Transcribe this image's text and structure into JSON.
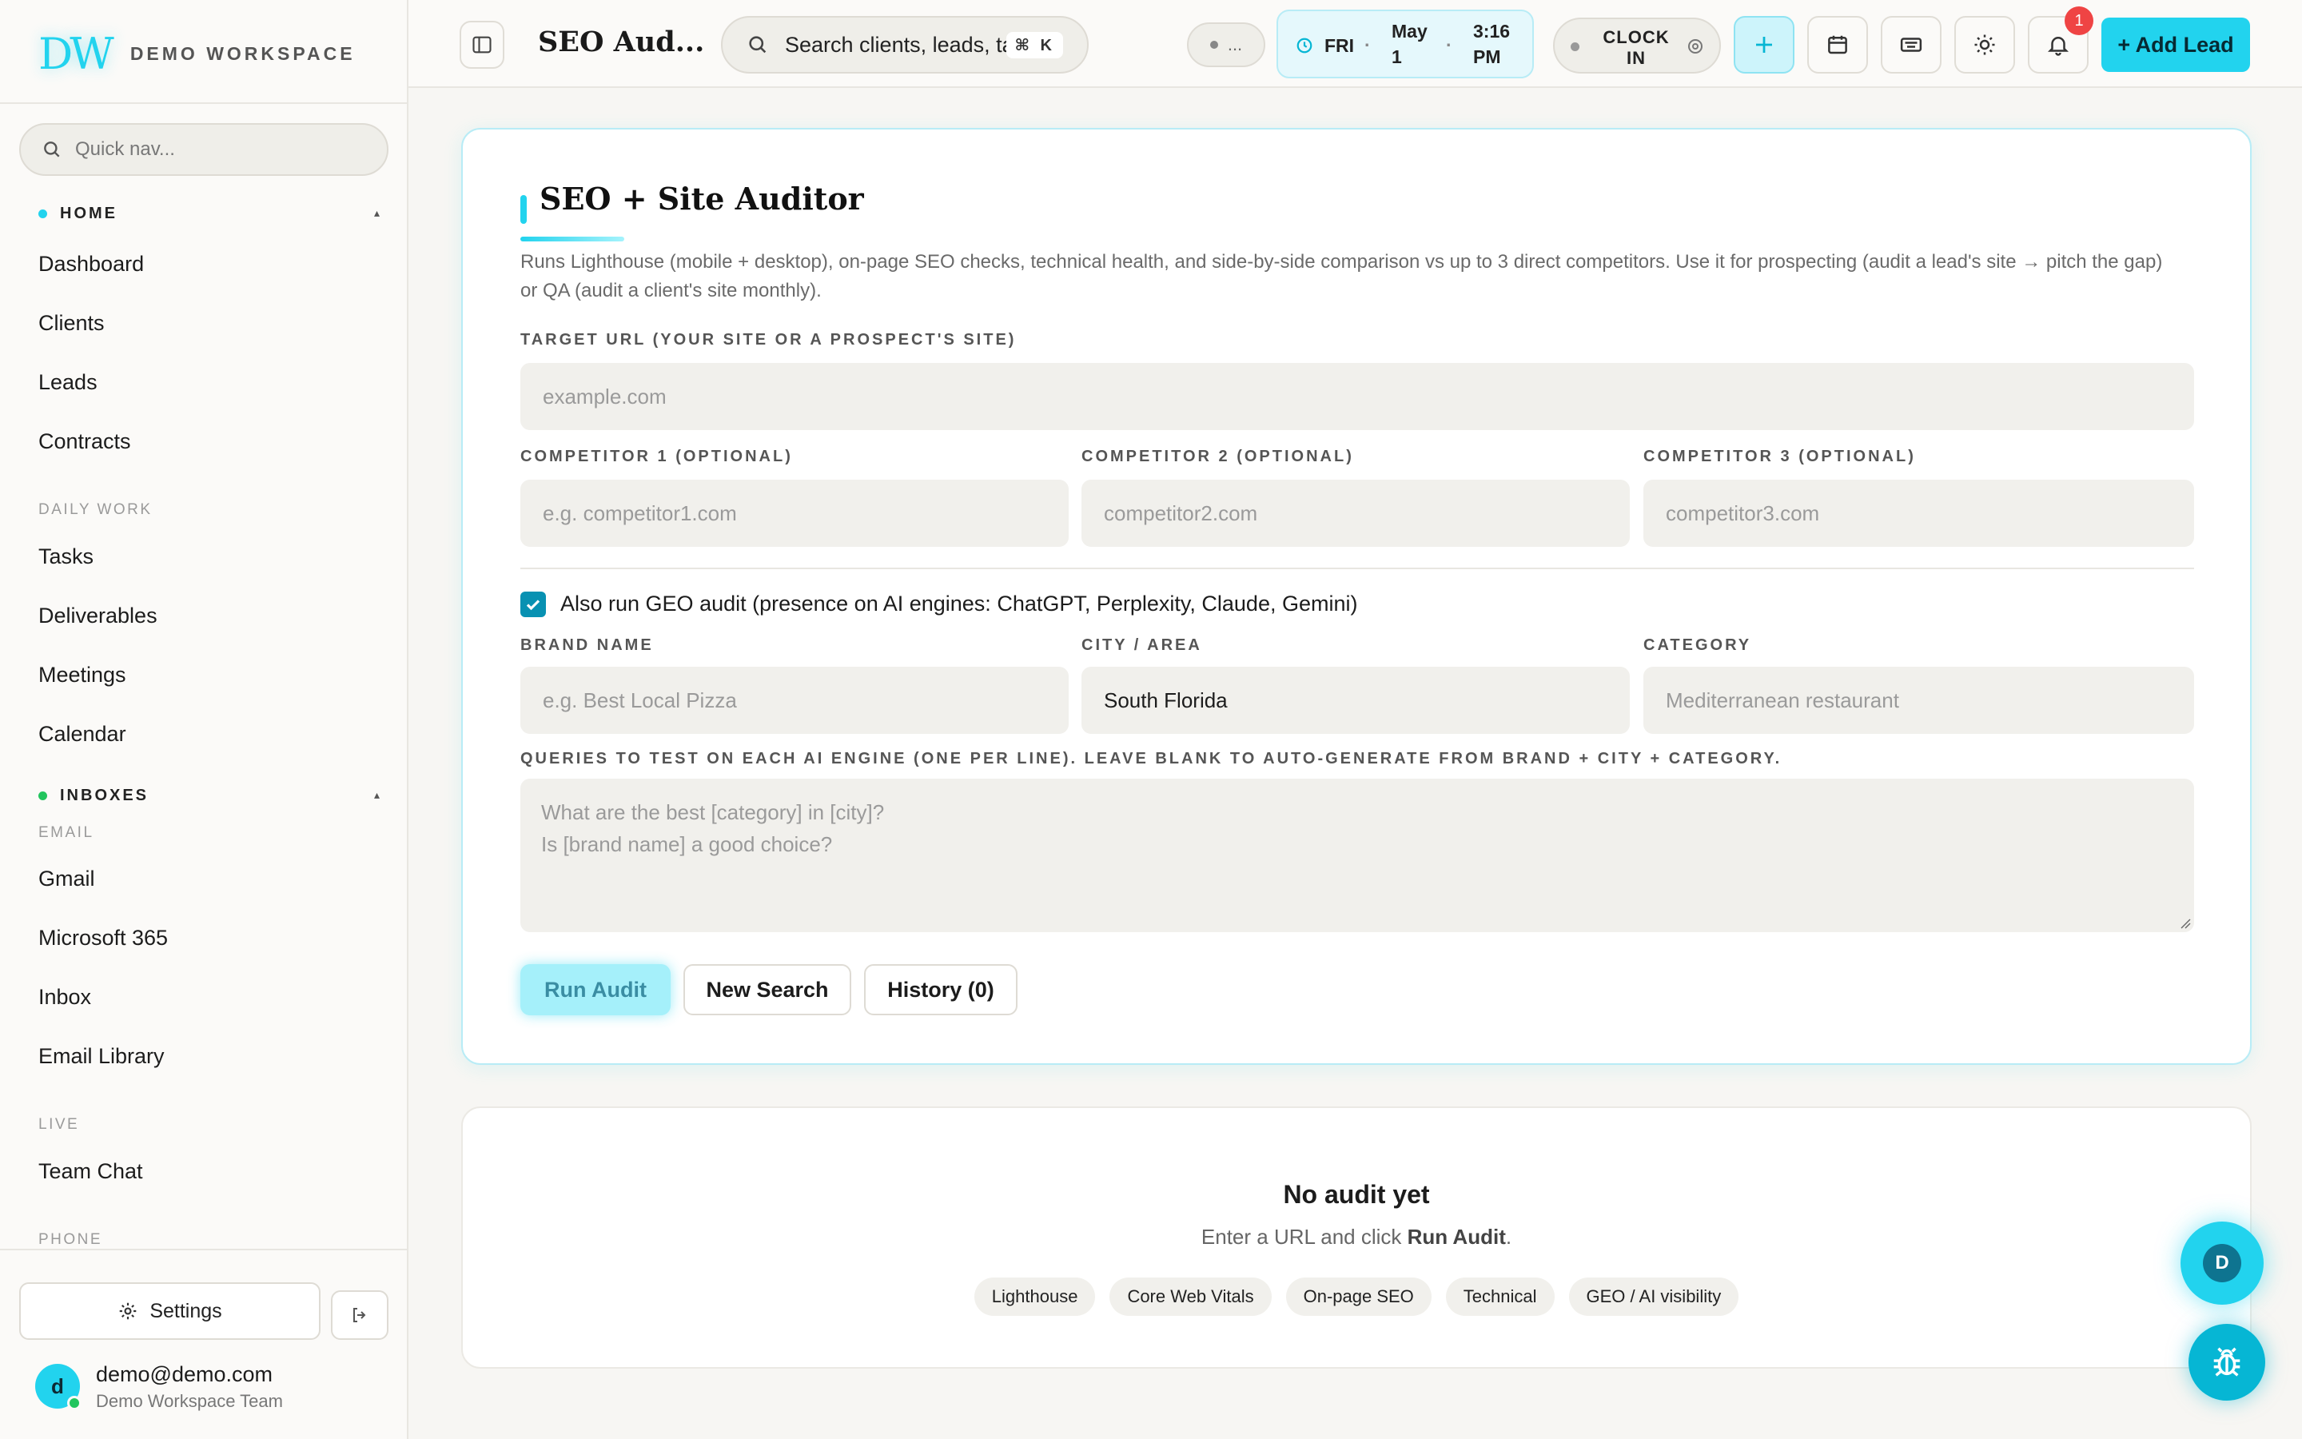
{
  "sidebar": {
    "brand_logo": "DW",
    "brand_name": "DEMO WORKSPACE",
    "quicknav_placeholder": "Quick nav...",
    "sections": {
      "home": {
        "label": "HOME",
        "color": "#22d3ee",
        "items": [
          "Dashboard",
          "Clients",
          "Leads",
          "Contracts"
        ]
      },
      "daily_work": {
        "label": "DAILY WORK",
        "items": [
          "Tasks",
          "Deliverables",
          "Meetings",
          "Calendar"
        ]
      },
      "inboxes": {
        "label": "INBOXES",
        "color": "#22c55e",
        "email_label": "EMAIL",
        "items": [
          "Gmail",
          "Microsoft 365",
          "Inbox",
          "Email Library"
        ]
      },
      "live": {
        "label": "LIVE",
        "items": [
          "Team Chat"
        ]
      },
      "phone": {
        "label": "PHONE"
      }
    },
    "settings_label": "Settings",
    "user": {
      "initial": "d",
      "email": "demo@demo.com",
      "team": "Demo Workspace Team"
    }
  },
  "header": {
    "title": "SEO Aud...",
    "search_text": "Search clients, leads, tasks...",
    "search_shortcut": "⌘ K",
    "status_text": "...",
    "date": {
      "day": "FRI",
      "month": "May",
      "date": "1",
      "time": "3:16",
      "ampm": "PM"
    },
    "clock_in_line1": "CLOCK",
    "clock_in_line2": "IN",
    "notification_count": "1",
    "add_lead_label": "+ Add Lead"
  },
  "auditor": {
    "title": "SEO + Site Auditor",
    "description": "Runs Lighthouse (mobile + desktop), on-page SEO checks, technical health, and side-by-side comparison vs up to 3 direct competitors. Use it for prospecting (audit a lead's site → pitch the gap) or QA (audit a client's site monthly).",
    "target_url_label": "TARGET URL (YOUR SITE OR A PROSPECT'S SITE)",
    "target_url_placeholder": "example.com",
    "competitors": [
      {
        "label": "COMPETITOR 1 (OPTIONAL)",
        "placeholder": "e.g. competitor1.com"
      },
      {
        "label": "COMPETITOR 2 (OPTIONAL)",
        "placeholder": "competitor2.com"
      },
      {
        "label": "COMPETITOR 3 (OPTIONAL)",
        "placeholder": "competitor3.com"
      }
    ],
    "geo_checkbox_checked": true,
    "geo_checkbox_label": "Also run GEO audit (presence on AI engines: ChatGPT, Perplexity, Claude, Gemini)",
    "brand_name_label": "BRAND NAME",
    "brand_name_placeholder": "e.g. Best Local Pizza",
    "city_label": "CITY / AREA",
    "city_value": "South Florida",
    "category_label": "CATEGORY",
    "category_placeholder": "Mediterranean restaurant",
    "queries_label": "QUERIES TO TEST ON EACH AI ENGINE (ONE PER LINE). LEAVE BLANK TO AUTO-GENERATE FROM BRAND + CITY + CATEGORY.",
    "queries_placeholder_line1": "What are the best [category] in [city]?",
    "queries_placeholder_line2": "Is [brand name] a good choice?",
    "run_label": "Run Audit",
    "new_search_label": "New Search",
    "history_label": "History (0)"
  },
  "empty_state": {
    "title": "No audit yet",
    "sub_prefix": "Enter a URL and click",
    "sub_bold": "Run Audit",
    "sub_suffix": ".",
    "tags": [
      "Lighthouse",
      "Core Web Vitals",
      "On-page SEO",
      "Technical",
      "GEO / AI visibility"
    ]
  },
  "floating": {
    "assistant_initial": "D"
  },
  "colors": {
    "accent": "#22d3ee",
    "accent_dark": "#0e7490",
    "badge": "#ef4444",
    "online": "#22c55e"
  }
}
